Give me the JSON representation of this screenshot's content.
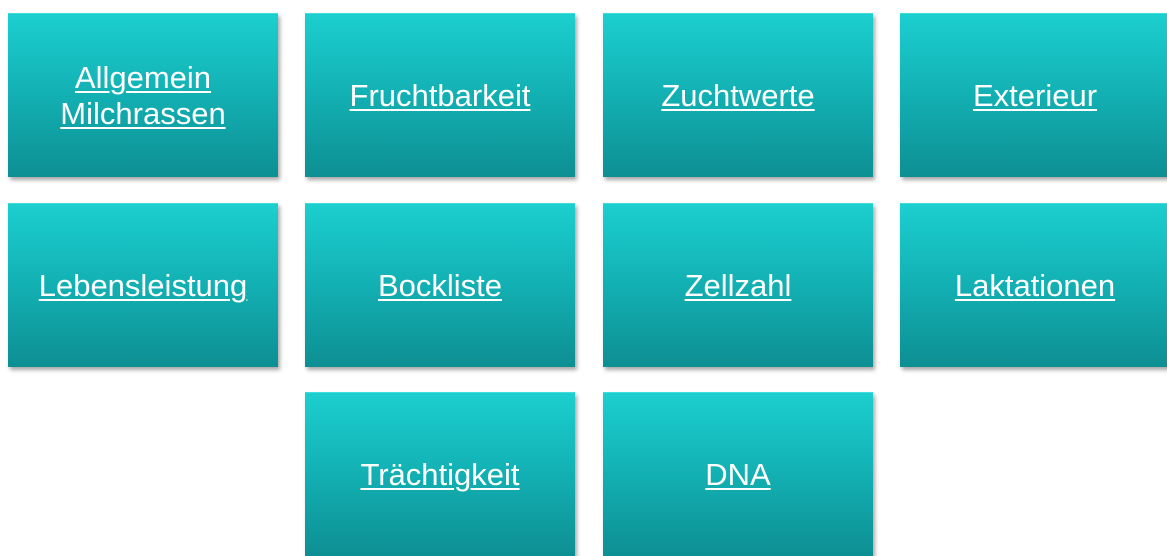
{
  "tiles": [
    {
      "label": "Allgemein\nMilchrassen"
    },
    {
      "label": "Fruchtbarkeit"
    },
    {
      "label": "Zuchtwerte"
    },
    {
      "label": "Exterieur"
    },
    {
      "label": "Lebensleistung"
    },
    {
      "label": "Bockliste"
    },
    {
      "label": "Zellzahl"
    },
    {
      "label": "Laktationen"
    },
    {
      "label": "Trächtigkeit"
    },
    {
      "label": "DNA"
    }
  ],
  "colors": {
    "tile_top": "#1ccfcf",
    "tile_bottom": "#0d8f93",
    "text": "#ffffff",
    "background": "#ffffff"
  }
}
